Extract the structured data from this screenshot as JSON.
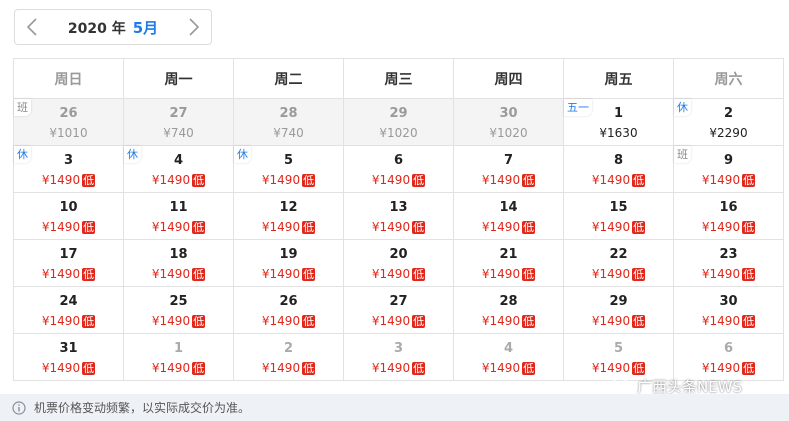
{
  "header": {
    "year_label": "2020 年",
    "month_label": "5月"
  },
  "weekdays": [
    "周日",
    "周一",
    "周二",
    "周三",
    "周四",
    "周五",
    "周六"
  ],
  "weeks": [
    [
      {
        "day": "26",
        "price": "¥1010",
        "low": false,
        "state": "muted",
        "tag": "班",
        "tag_type": "work"
      },
      {
        "day": "27",
        "price": "¥740",
        "low": false,
        "state": "muted",
        "tag": "",
        "tag_type": ""
      },
      {
        "day": "28",
        "price": "¥740",
        "low": false,
        "state": "muted",
        "tag": "",
        "tag_type": ""
      },
      {
        "day": "29",
        "price": "¥1020",
        "low": false,
        "state": "muted",
        "tag": "",
        "tag_type": ""
      },
      {
        "day": "30",
        "price": "¥1020",
        "low": false,
        "state": "muted",
        "tag": "",
        "tag_type": ""
      },
      {
        "day": "1",
        "price": "¥1630",
        "low": false,
        "state": "normal",
        "tag": "五一",
        "tag_type": "holiday"
      },
      {
        "day": "2",
        "price": "¥2290",
        "low": false,
        "state": "normal",
        "tag": "休",
        "tag_type": "rest"
      }
    ],
    [
      {
        "day": "3",
        "price": "¥1490",
        "low": true,
        "state": "active",
        "tag": "休",
        "tag_type": "rest"
      },
      {
        "day": "4",
        "price": "¥1490",
        "low": true,
        "state": "active",
        "tag": "休",
        "tag_type": "rest"
      },
      {
        "day": "5",
        "price": "¥1490",
        "low": true,
        "state": "active",
        "tag": "休",
        "tag_type": "rest"
      },
      {
        "day": "6",
        "price": "¥1490",
        "low": true,
        "state": "active",
        "tag": "",
        "tag_type": ""
      },
      {
        "day": "7",
        "price": "¥1490",
        "low": true,
        "state": "active",
        "tag": "",
        "tag_type": ""
      },
      {
        "day": "8",
        "price": "¥1490",
        "low": true,
        "state": "active",
        "tag": "",
        "tag_type": ""
      },
      {
        "day": "9",
        "price": "¥1490",
        "low": true,
        "state": "active",
        "tag": "班",
        "tag_type": "work"
      }
    ],
    [
      {
        "day": "10",
        "price": "¥1490",
        "low": true,
        "state": "active",
        "tag": "",
        "tag_type": ""
      },
      {
        "day": "11",
        "price": "¥1490",
        "low": true,
        "state": "active",
        "tag": "",
        "tag_type": ""
      },
      {
        "day": "12",
        "price": "¥1490",
        "low": true,
        "state": "active",
        "tag": "",
        "tag_type": ""
      },
      {
        "day": "13",
        "price": "¥1490",
        "low": true,
        "state": "active",
        "tag": "",
        "tag_type": ""
      },
      {
        "day": "14",
        "price": "¥1490",
        "low": true,
        "state": "active",
        "tag": "",
        "tag_type": ""
      },
      {
        "day": "15",
        "price": "¥1490",
        "low": true,
        "state": "active",
        "tag": "",
        "tag_type": ""
      },
      {
        "day": "16",
        "price": "¥1490",
        "low": true,
        "state": "active",
        "tag": "",
        "tag_type": ""
      }
    ],
    [
      {
        "day": "17",
        "price": "¥1490",
        "low": true,
        "state": "active",
        "tag": "",
        "tag_type": ""
      },
      {
        "day": "18",
        "price": "¥1490",
        "low": true,
        "state": "active",
        "tag": "",
        "tag_type": ""
      },
      {
        "day": "19",
        "price": "¥1490",
        "low": true,
        "state": "active",
        "tag": "",
        "tag_type": ""
      },
      {
        "day": "20",
        "price": "¥1490",
        "low": true,
        "state": "active",
        "tag": "",
        "tag_type": ""
      },
      {
        "day": "21",
        "price": "¥1490",
        "low": true,
        "state": "active",
        "tag": "",
        "tag_type": ""
      },
      {
        "day": "22",
        "price": "¥1490",
        "low": true,
        "state": "active",
        "tag": "",
        "tag_type": ""
      },
      {
        "day": "23",
        "price": "¥1490",
        "low": true,
        "state": "active",
        "tag": "",
        "tag_type": ""
      }
    ],
    [
      {
        "day": "24",
        "price": "¥1490",
        "low": true,
        "state": "active",
        "tag": "",
        "tag_type": ""
      },
      {
        "day": "25",
        "price": "¥1490",
        "low": true,
        "state": "active",
        "tag": "",
        "tag_type": ""
      },
      {
        "day": "26",
        "price": "¥1490",
        "low": true,
        "state": "active",
        "tag": "",
        "tag_type": ""
      },
      {
        "day": "27",
        "price": "¥1490",
        "low": true,
        "state": "active",
        "tag": "",
        "tag_type": ""
      },
      {
        "day": "28",
        "price": "¥1490",
        "low": true,
        "state": "active",
        "tag": "",
        "tag_type": ""
      },
      {
        "day": "29",
        "price": "¥1490",
        "low": true,
        "state": "active",
        "tag": "",
        "tag_type": ""
      },
      {
        "day": "30",
        "price": "¥1490",
        "low": true,
        "state": "active",
        "tag": "",
        "tag_type": ""
      }
    ],
    [
      {
        "day": "31",
        "price": "¥1490",
        "low": true,
        "state": "active",
        "tag": "",
        "tag_type": ""
      },
      {
        "day": "1",
        "price": "¥1490",
        "low": true,
        "state": "future",
        "tag": "",
        "tag_type": ""
      },
      {
        "day": "2",
        "price": "¥1490",
        "low": true,
        "state": "future",
        "tag": "",
        "tag_type": ""
      },
      {
        "day": "3",
        "price": "¥1490",
        "low": true,
        "state": "future",
        "tag": "",
        "tag_type": ""
      },
      {
        "day": "4",
        "price": "¥1490",
        "low": true,
        "state": "future",
        "tag": "",
        "tag_type": ""
      },
      {
        "day": "5",
        "price": "¥1490",
        "low": true,
        "state": "future",
        "tag": "",
        "tag_type": ""
      },
      {
        "day": "6",
        "price": "¥1490",
        "low": true,
        "state": "future",
        "tag": "",
        "tag_type": ""
      }
    ]
  ],
  "low_badge_label": "低",
  "footer": {
    "notice": "机票价格变动频繁，以实际成交价为准。",
    "icon": "info-icon"
  },
  "watermark": {
    "text": "广西头条NEWS",
    "icon": "wechat-icon"
  },
  "colors": {
    "accent": "#1e7ce8",
    "price_red": "#e0271a",
    "muted_bg": "#f4f4f4",
    "footer_bg": "#eef2f7"
  }
}
